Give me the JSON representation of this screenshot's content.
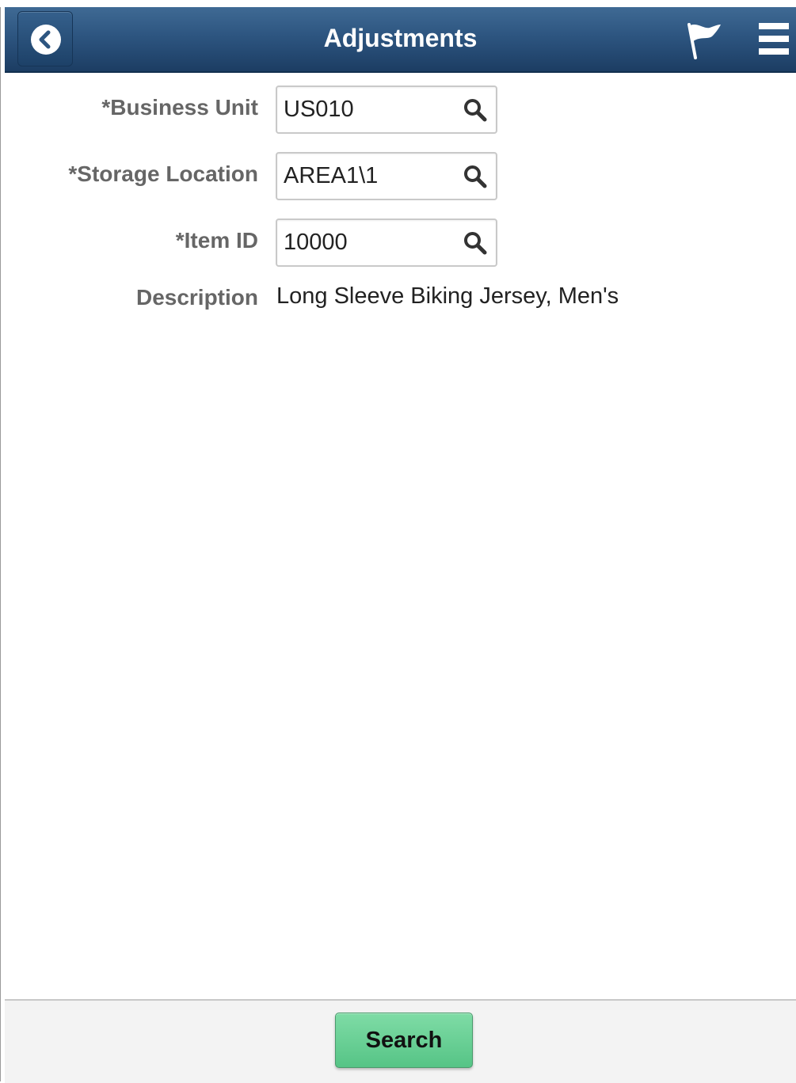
{
  "header": {
    "title": "Adjustments",
    "back_icon": "chevron-left-icon",
    "flag_icon": "flag-icon",
    "menu_icon": "hamburger-menu-icon",
    "color": "#2d5580"
  },
  "form": {
    "business_unit": {
      "label": "*Business Unit",
      "value": "US010"
    },
    "storage_location": {
      "label": "*Storage Location",
      "value": "AREA1\\1"
    },
    "item_id": {
      "label": "*Item ID",
      "value": "10000"
    },
    "description": {
      "label": "Description",
      "value": "Long Sleeve Biking Jersey, Men's"
    },
    "lookup_icon": "search-icon"
  },
  "footer": {
    "search_label": "Search",
    "search_color": "#6ad297"
  }
}
